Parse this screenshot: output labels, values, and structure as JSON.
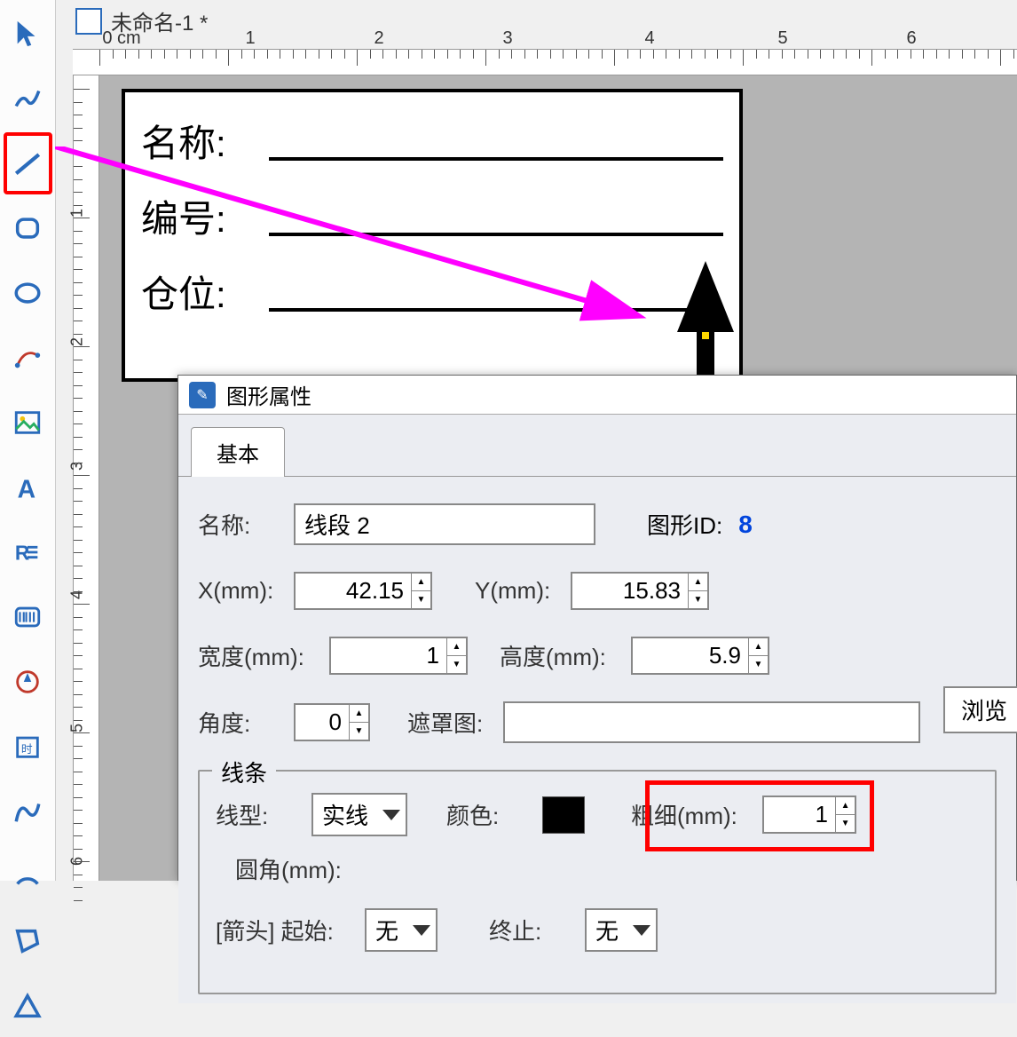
{
  "document": {
    "title": "未命名-1 *"
  },
  "ruler": {
    "unit_label": "0 cm",
    "h_labels": [
      "0 cm",
      "1",
      "2",
      "3",
      "4",
      "5",
      "6"
    ],
    "v_labels": [
      "1",
      "2",
      "3",
      "4",
      "5",
      "6"
    ]
  },
  "canvas": {
    "labels": {
      "name": "名称:",
      "number": "编号:",
      "position": "仓位:"
    }
  },
  "dialog": {
    "title": "图形属性",
    "tab_basic": "基本",
    "name_lbl": "名称:",
    "name_val": "线段 2",
    "id_lbl": "图形ID:",
    "id_val": "8",
    "x_lbl": "X(mm):",
    "x_val": "42.15",
    "y_lbl": "Y(mm):",
    "y_val": "15.83",
    "w_lbl": "宽度(mm):",
    "w_val": "1",
    "h_lbl": "高度(mm):",
    "h_val": "5.9",
    "angle_lbl": "角度:",
    "angle_val": "0",
    "mask_lbl": "遮罩图:",
    "browse_lbl": "浏览",
    "line_group": "线条",
    "linetype_lbl": "线型:",
    "linetype_val": "实线",
    "color_lbl": "颜色:",
    "thick_lbl": "粗细(mm):",
    "thick_val": "1",
    "round_lbl": "圆角(mm):",
    "arrow_lbl": "[箭头] 起始:",
    "arrow_start_val": "无",
    "arrow_end_lbl": "终止:",
    "arrow_end_val": "无"
  },
  "tools": [
    "pointer",
    "freehand",
    "line",
    "rounded-rect",
    "ellipse",
    "edit-path",
    "image",
    "text",
    "richtext",
    "barcode",
    "measure",
    "date",
    "curve",
    "arc",
    "polygon",
    "triangle"
  ]
}
